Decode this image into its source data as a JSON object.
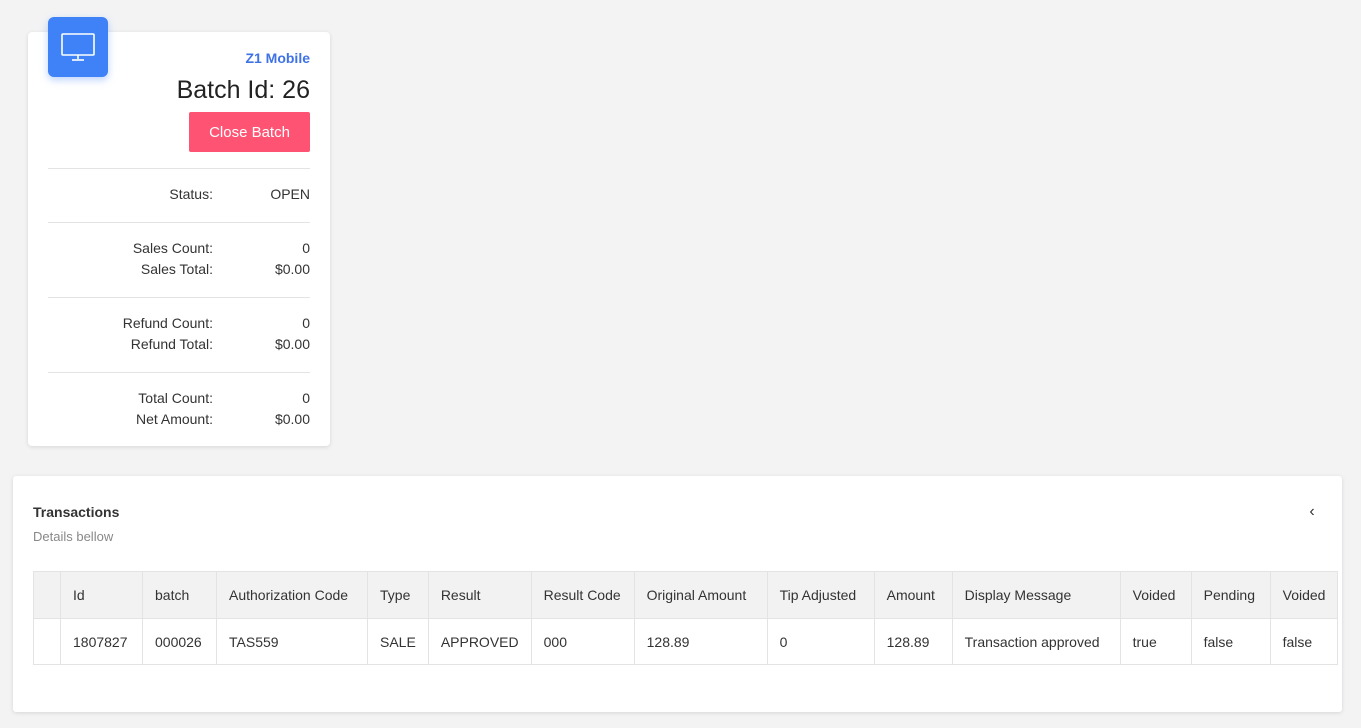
{
  "batch_card": {
    "device_name": "Z1 Mobile",
    "batch_id_label": "Batch Id: 26",
    "close_button": "Close Batch",
    "stats": {
      "status_label": "Status:",
      "status_value": "OPEN",
      "sales_count_label": "Sales Count:",
      "sales_count_value": "0",
      "sales_total_label": "Sales Total:",
      "sales_total_value": "$0.00",
      "refund_count_label": "Refund Count:",
      "refund_count_value": "0",
      "refund_total_label": "Refund Total:",
      "refund_total_value": "$0.00",
      "total_count_label": "Total Count:",
      "total_count_value": "0",
      "net_amount_label": "Net Amount:",
      "net_amount_value": "$0.00"
    }
  },
  "transactions": {
    "title": "Transactions",
    "subtitle": "Details bellow",
    "collapse_icon": "chevron-left-icon",
    "columns": [
      "Id",
      "batch",
      "Authorization Code",
      "Type",
      "Result",
      "Result Code",
      "Original Amount",
      "Tip Adjusted",
      "Amount",
      "Display Message",
      "Voided",
      "Pending",
      "Voided"
    ],
    "rows": [
      [
        "1807827",
        "000026",
        "TAS559",
        "SALE",
        "APPROVED",
        "000",
        "128.89",
        "0",
        "128.89",
        "Transaction approved",
        "true",
        "false",
        "false"
      ]
    ]
  },
  "colors": {
    "background": "#f3f3f4",
    "accent_blue": "#3f82f7",
    "device_name_blue": "#3f72e5",
    "close_button_red": "#ff5373"
  }
}
